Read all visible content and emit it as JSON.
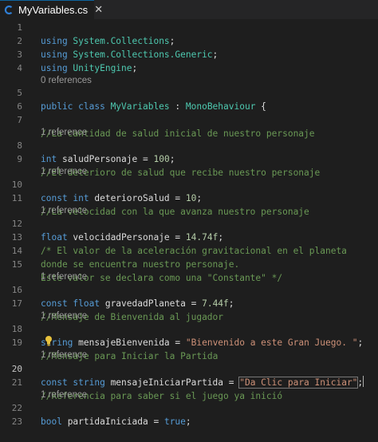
{
  "tab": {
    "title": "MyVariables.cs",
    "icon": "csharp-file-icon",
    "close_glyph": "✕"
  },
  "gutter": [
    "1",
    "2",
    "3",
    "4",
    "5",
    "6",
    "7",
    "8",
    "9",
    "10",
    "11",
    "12",
    "13",
    "14",
    "15",
    "16",
    "17",
    "18",
    "19",
    "20",
    "21",
    "22",
    "23"
  ],
  "lenses": {
    "class": "0 references",
    "r1": "1 reference",
    "r2": "1 reference",
    "r3": "1 reference",
    "r4": "1 reference",
    "r5": "1 reference",
    "r6": "1 reference",
    "r7": "1 reference",
    "r8": "1 reference"
  },
  "code": {
    "l1": {
      "kw": "using",
      "ns": " System.Collections",
      "p": ";"
    },
    "l2": {
      "kw": "using",
      "ns": " System.Collections.Generic",
      "p": ";"
    },
    "l3": {
      "kw": "using",
      "ns": " UnityEngine",
      "p": ";"
    },
    "l5": {
      "kw": "public class",
      "name": " MyVariables",
      "p": " : ",
      "base": "MonoBehaviour",
      "brace": " {"
    },
    "l7": {
      "cm": "//La cantidad de salud inicial de nuestro personaje"
    },
    "l8": {
      "kw": "int",
      "id": " saludPersonaje",
      "eq": " = ",
      "num": "100",
      "p": ";"
    },
    "l9": {
      "cm": "//El deterioro de salud que recibe nuestro personaje"
    },
    "l10": {
      "kw": "const int",
      "id": " deterioroSalud",
      "eq": " = ",
      "num": "10",
      "p": ";"
    },
    "l11": {
      "cm": "//La velocidad con la que avanza nuestro personaje"
    },
    "l12": {
      "kw": "float",
      "id": " velocidadPersonaje",
      "eq": " = ",
      "num": "14.74f",
      "p": ";"
    },
    "l13": {
      "cm": "/* El valor de la aceleración gravitacional en el planeta"
    },
    "l14": {
      "cm": "donde se encuentra nuestro personaje."
    },
    "l15": {
      "cm": "Este valor se declara como una \"Constante\" */"
    },
    "l16": {
      "kw": "const float",
      "id": " gravedadPlaneta",
      "eq": " = ",
      "num": "7.44f",
      "p": ";"
    },
    "l17": {
      "cm": "//Mensaje de Bienvenida al jugador"
    },
    "l18": {
      "kw": "string",
      "id": " mensajeBienvenida",
      "eq": " = ",
      "str": "\"Bienvenido a este Gran Juego. \"",
      "p": ";"
    },
    "l19": {
      "cm_a": "/",
      "cm_b": "Mensaje para Iniciar la Partida",
      "icon": "lightbulb-icon"
    },
    "l20": {
      "kw": "const string",
      "id": " mensajeIniciarPartida",
      "eq": " = ",
      "str": "\"Da Clic para Iniciar\"",
      "p": ";"
    },
    "l21": {
      "cm": "//Referencia para saber si el juego ya inició"
    },
    "l22": {
      "kw": "bool",
      "id": " partidaIniciada",
      "eq": " = ",
      "val": "true",
      "p": ";"
    }
  },
  "colors": {
    "background": "#1e1e1e",
    "keyword": "#569cd6",
    "type": "#4ec9b0",
    "comment": "#6a9955",
    "string": "#ce9178",
    "number": "#b5cea8"
  }
}
